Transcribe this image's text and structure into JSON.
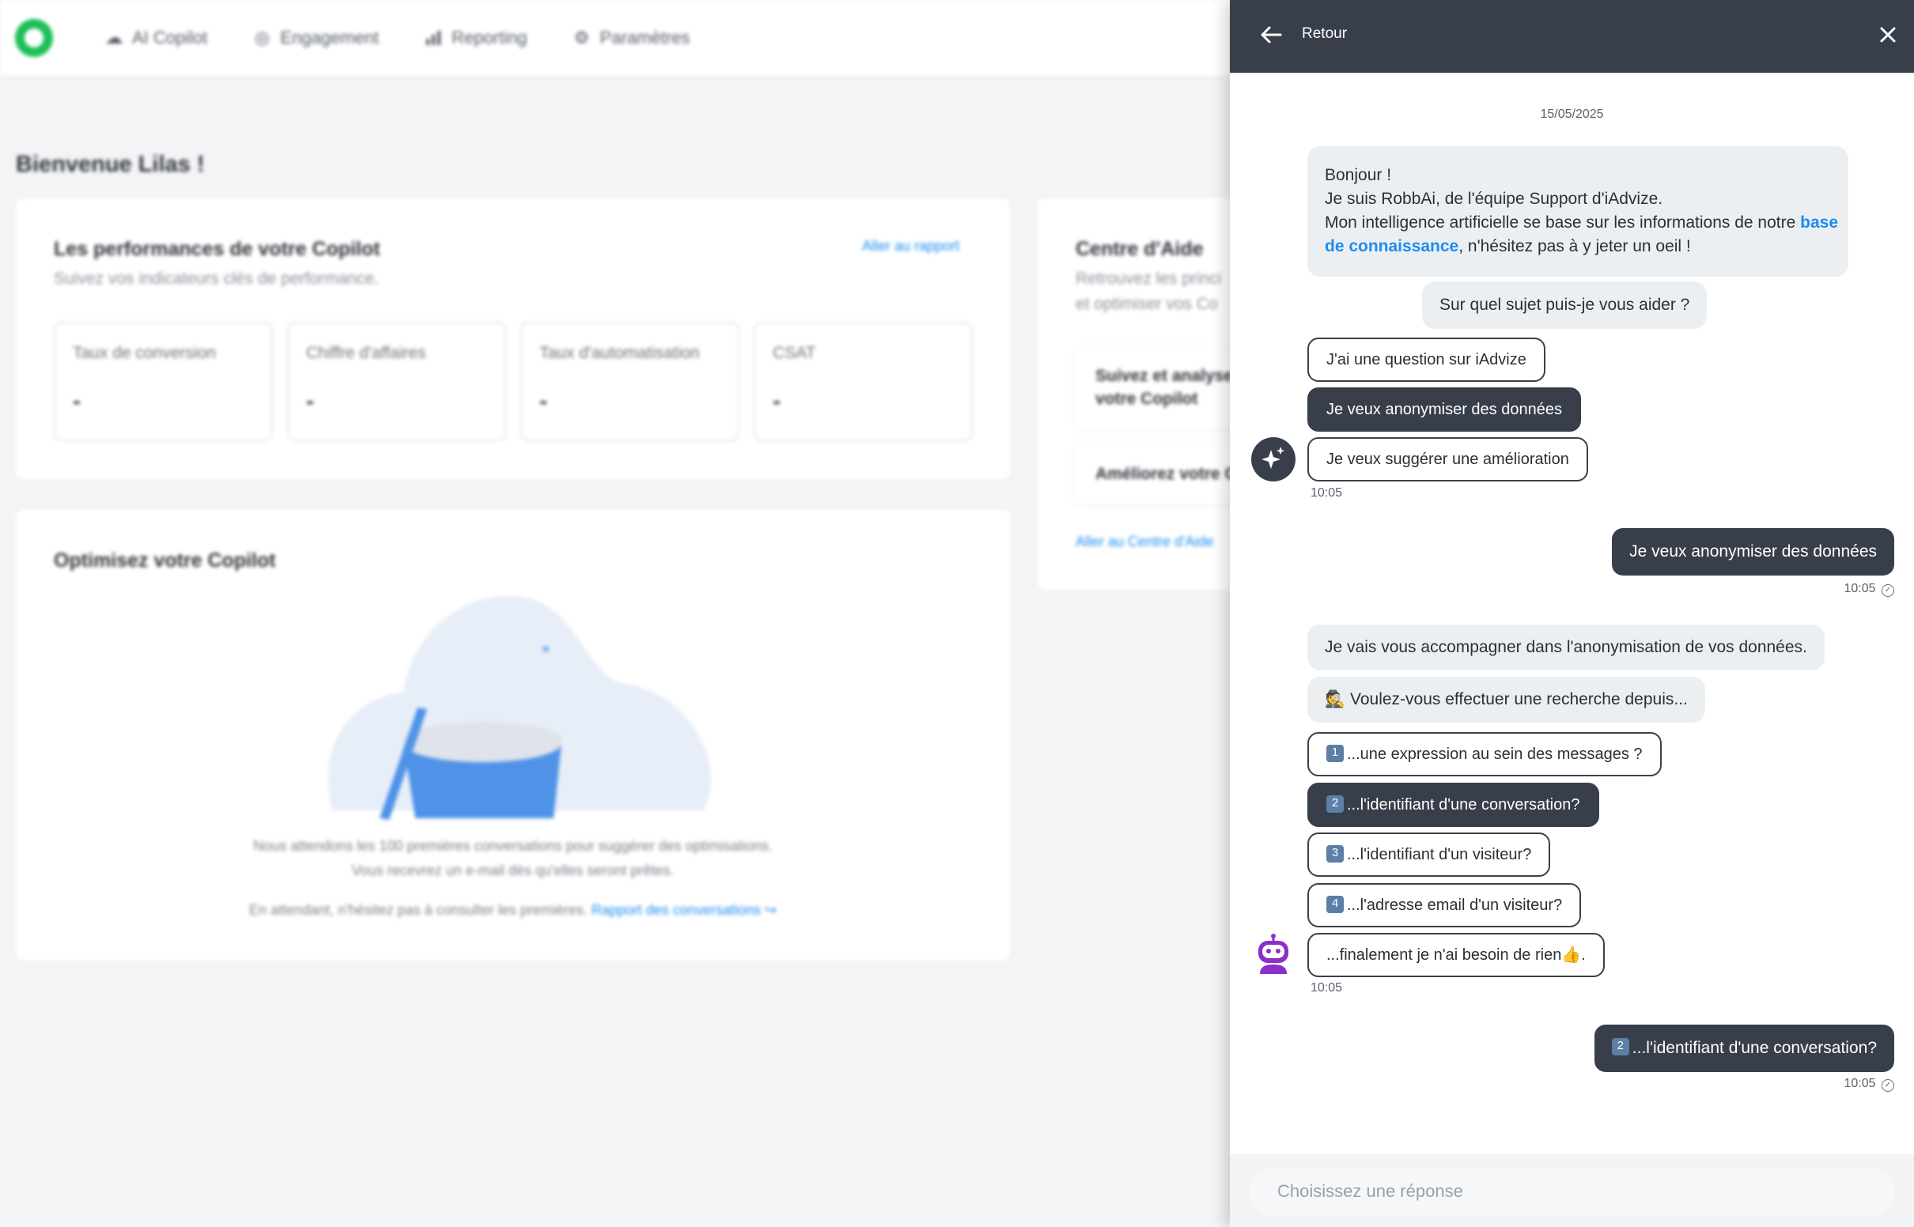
{
  "nav": {
    "items": [
      {
        "label": "AI Copilot",
        "icon": "cloud-icon"
      },
      {
        "label": "Engagement",
        "icon": "target-icon"
      },
      {
        "label": "Reporting",
        "icon": "bar-chart-icon"
      },
      {
        "label": "Paramètres",
        "icon": "gear-icon"
      }
    ]
  },
  "dashboard": {
    "welcome": "Bienvenue Lilas !",
    "performance": {
      "title": "Les performances de votre Copilot",
      "subtitle": "Suivez vos indicateurs clés de performance.",
      "link": "Aller au rapport",
      "kpis": [
        {
          "label": "Taux de conversion",
          "value": "-"
        },
        {
          "label": "Chiffre d'affaires",
          "value": "-"
        },
        {
          "label": "Taux d'automatisation",
          "value": "-"
        },
        {
          "label": "CSAT",
          "value": "-"
        }
      ]
    },
    "optimize": {
      "title": "Optimisez votre Copilot",
      "line1": "Nous attendons les 100 premières conversations pour suggérer des optimisations.",
      "line2": "Vous recevrez un e-mail dès qu'elles seront prêtes.",
      "line3": "En attendant, n'hésitez pas à consulter les premières.",
      "link": "Rapport des conversations"
    },
    "help": {
      "title": "Centre d'Aide",
      "subtitle1": "Retrouvez les princi",
      "subtitle2": "et optimiser vos Co",
      "item1_line1": "Suivez et analyse",
      "item1_line2": "votre Copilot",
      "item2": "Améliorez votre C",
      "link": "Aller au Centre d'Aide"
    }
  },
  "chat": {
    "header": {
      "back_label": "Retour"
    },
    "date": "15/05/2025",
    "intro": {
      "line1": "Bonjour !",
      "line2": "Je suis RobbAi, de l'équipe Support d'iAdvize.",
      "line3_before": "Mon intelligence artificielle se base sur les informations de notre ",
      "link_part1": "base",
      "link_part2": "de connaissance",
      "line4_after": ", n'hésitez pas à y jeter un oeil !"
    },
    "question1": "Sur quel sujet puis-je vous aider ?",
    "options1": [
      "J'ai une question sur iAdvize",
      "Je veux anonymiser des données",
      "Je veux suggérer une amélioration"
    ],
    "time1": "10:05",
    "user_reply1": "Je veux anonymiser des données",
    "user_time1": "10:05",
    "bot_msg2": "Je vais vous accompagner dans l'anonymisation de vos données.",
    "bot_msg3_emoji": "🕵",
    "bot_msg3": "Voulez-vous effectuer une recherche depuis...",
    "options2": [
      {
        "key": "1",
        "label": "...une expression au sein des messages ?"
      },
      {
        "key": "2",
        "label": "...l'identifiant d'une conversation?"
      },
      {
        "key": "3",
        "label": "...l'identifiant d'un visiteur?"
      },
      {
        "key": "4",
        "label": "...l'adresse email d'un visiteur?"
      }
    ],
    "option_none": "...finalement je n'ai besoin de rien",
    "option_none_emoji": "👍",
    "option_none_tail": ".",
    "time2": "10:05",
    "user_reply2_key": "2",
    "user_reply2": "...l'identifiant d'une conversation?",
    "user_time2": "10:05",
    "read_mark": "✓",
    "input_placeholder": "Choisissez une réponse"
  }
}
